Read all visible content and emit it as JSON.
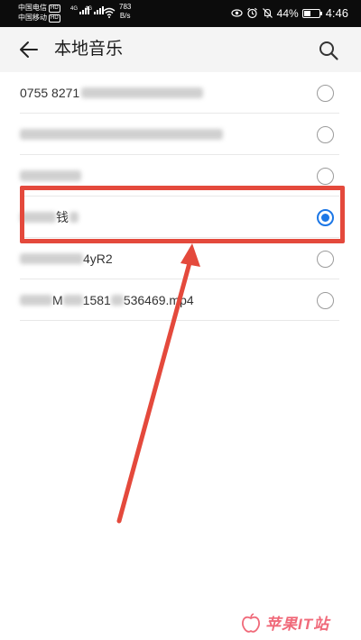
{
  "status_bar": {
    "carrier_1": "中国电信",
    "carrier_2": "中国移动",
    "hd_badge": "HD",
    "network_1": "4G",
    "network_2": "4G",
    "net_speed_value": "783",
    "net_speed_unit": "B/s",
    "battery_percent": "44%",
    "battery_level": 0.44,
    "time": "4:46",
    "icons": [
      "eye-comfort-icon",
      "alarm-icon",
      "mute-icon",
      "battery-icon",
      "wifi-icon",
      "signal-icon"
    ]
  },
  "header": {
    "back_icon": "arrow-left-icon",
    "title": "本地音乐",
    "search_icon": "search-icon"
  },
  "song_list": {
    "items": [
      {
        "visible_text_before": "0755 8271",
        "visible_text_after": "",
        "selected": false
      },
      {
        "visible_text_before": "",
        "visible_text_after": "",
        "selected": false
      },
      {
        "visible_text_before": "",
        "visible_text_after": "",
        "selected": false
      },
      {
        "visible_text_before": "",
        "visible_text_after": "钱",
        "selected": true
      },
      {
        "visible_text_before": "",
        "visible_text_after": "4yR2",
        "selected": false
      },
      {
        "visible_text_before": "",
        "visible_text_after": "M",
        "mid_text": "1581",
        "end_text": "536469.mp4",
        "selected": false
      }
    ]
  },
  "annotation": {
    "color": "#e4493c",
    "accent_color": "#1c77e6"
  },
  "watermark": {
    "text": "苹果IT站"
  }
}
